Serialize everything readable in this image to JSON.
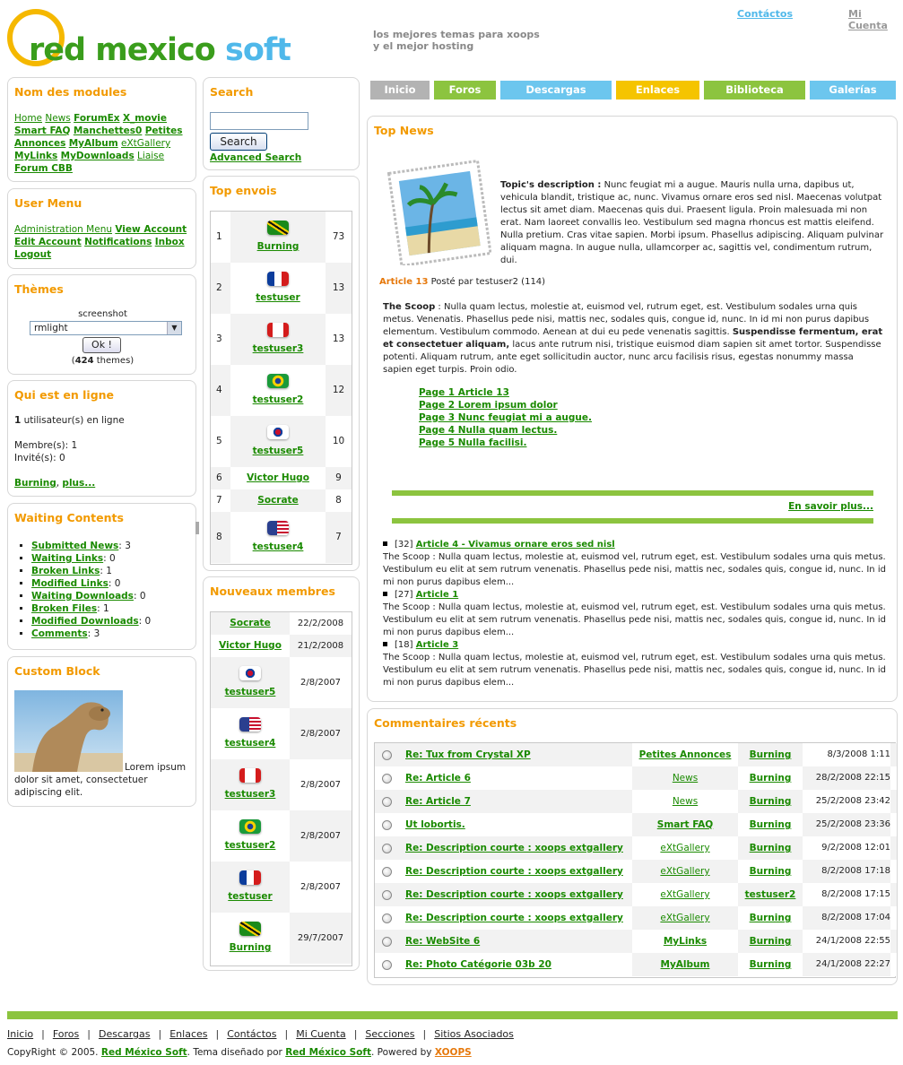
{
  "site": {
    "logo_name": "red mexico",
    "logo_name2": "soft",
    "tagline1": "los mejores temas para xoops",
    "tagline2": "y el mejor hosting",
    "top_contactos": "Contáctos",
    "top_micuenta": "Mi Cuenta"
  },
  "nav": [
    {
      "label": "Inicio",
      "color": "#b3b3b3"
    },
    {
      "label": "Foros",
      "color": "#8cc43f"
    },
    {
      "label": "Descargas",
      "color": "#6cc6ee"
    },
    {
      "label": "Enlaces",
      "color": "#f5c400"
    },
    {
      "label": "Biblioteca",
      "color": "#8cc43f"
    },
    {
      "label": "Galerías",
      "color": "#6cc6ee"
    }
  ],
  "modules": {
    "title": "Nom des modules",
    "links": [
      "Home",
      "News",
      "ForumEx",
      "X_movie",
      "Smart FAQ",
      "Manchettes0",
      "Petites Annonces",
      "MyAlbum",
      "eXtGallery",
      "MyLinks",
      "MyDownloads",
      "Liaise",
      "Forum CBB"
    ]
  },
  "usermenu": {
    "title": "User Menu",
    "links": [
      "Administration Menu",
      "View Account",
      "Edit Account",
      "Notifications",
      "Inbox",
      "Logout"
    ]
  },
  "themes": {
    "title": "Thèmes",
    "screenshot": "screenshot",
    "selected": "rmlight",
    "ok": "Ok !",
    "count": "424",
    "count_label": "themes"
  },
  "online": {
    "title": "Qui est en ligne",
    "count": "1",
    "count_label": "utilisateur(s) en ligne",
    "members": "Membre(s): 1",
    "guests": "Invité(s): 0",
    "user": "Burning",
    "more": "plus..."
  },
  "waiting": {
    "title": "Waiting Contents",
    "items": [
      {
        "label": "Submitted News",
        "count": "3"
      },
      {
        "label": "Waiting Links",
        "count": "0"
      },
      {
        "label": "Broken Links",
        "count": "1"
      },
      {
        "label": "Modified Links",
        "count": "0"
      },
      {
        "label": "Waiting Downloads",
        "count": "0"
      },
      {
        "label": "Broken Files",
        "count": "1"
      },
      {
        "label": "Modified Downloads",
        "count": "0"
      },
      {
        "label": "Comments",
        "count": "3"
      }
    ]
  },
  "custom": {
    "title": "Custom Block",
    "text": "Lorem ipsum dolor sit amet, consectetuer adipiscing elit."
  },
  "search": {
    "title": "Search",
    "button": "Search",
    "advanced": "Advanced Search"
  },
  "topposters": {
    "title": "Top envois",
    "rows": [
      {
        "rank": "1",
        "user": "Burning",
        "count": "73",
        "flag": "jamaica"
      },
      {
        "rank": "2",
        "user": "testuser",
        "count": "13",
        "flag": "france"
      },
      {
        "rank": "3",
        "user": "testuser3",
        "count": "13",
        "flag": "canada"
      },
      {
        "rank": "4",
        "user": "testuser2",
        "count": "12",
        "flag": "brazil"
      },
      {
        "rank": "5",
        "user": "testuser5",
        "count": "10",
        "flag": "korea"
      },
      {
        "rank": "6",
        "user": "Victor Hugo",
        "count": "9",
        "flag": ""
      },
      {
        "rank": "7",
        "user": "Socrate",
        "count": "8",
        "flag": ""
      },
      {
        "rank": "8",
        "user": "testuser4",
        "count": "7",
        "flag": "usa"
      }
    ]
  },
  "newmembers": {
    "title": "Nouveaux membres",
    "rows": [
      {
        "user": "Socrate",
        "date": "22/2/2008",
        "flag": ""
      },
      {
        "user": "Victor Hugo",
        "date": "21/2/2008",
        "flag": ""
      },
      {
        "user": "testuser5",
        "date": "2/8/2007",
        "flag": "korea"
      },
      {
        "user": "testuser4",
        "date": "2/8/2007",
        "flag": "usa"
      },
      {
        "user": "testuser3",
        "date": "2/8/2007",
        "flag": "canada"
      },
      {
        "user": "testuser2",
        "date": "2/8/2007",
        "flag": "brazil"
      },
      {
        "user": "testuser",
        "date": "2/8/2007",
        "flag": "france"
      },
      {
        "user": "Burning",
        "date": "29/7/2007",
        "flag": "jamaica"
      }
    ]
  },
  "topnews": {
    "title": "Top News",
    "desc_label": "Topic's description :",
    "desc": "Nunc feugiat mi a augue. Mauris nulla urna, dapibus ut, vehicula blandit, tristique ac, nunc. Vivamus ornare eros sed nisl. Maecenas volutpat lectus sit amet diam. Maecenas quis dui. Praesent ligula. Proin malesuada mi non erat. Nam laoreet convallis leo. Vestibulum sed magna rhoncus est mattis eleifend. Nulla pretium. Cras vitae sapien. Morbi ipsum. Phasellus adipiscing. Aliquam pulvinar aliquam magna. In augue nulla, ullamcorper ac, sagittis vel, condimentum rutrum, dui.",
    "article_label": "Article 13",
    "article_meta": "Posté par testuser2 (114)",
    "scoop_label": "The Scoop",
    "scoop_a": ": Nulla quam lectus, molestie at, euismod vel, rutrum eget, est. Vestibulum sodales urna quis metus. Venenatis. Phasellus pede nisi, mattis nec, sodales quis, congue id, nunc. In id mi non purus dapibus elementum. Vestibulum commodo. Aenean at dui eu pede venenatis sagittis.",
    "scoop_bold": "Suspendisse fermentum, erat et consectetuer aliquam,",
    "scoop_b": "lacus ante rutrum nisi, tristique euismod diam sapien sit amet tortor. Suspendisse potenti. Aliquam rutrum, ante eget sollicitudin auctor, nunc arcu facilisis risus, egestas nonummy massa sapien eget turpis. Proin odio.",
    "pages": [
      "Page 1 Article 13",
      "Page 2 Lorem ipsum dolor",
      "Page 3 Nunc feugiat mi a augue.",
      "Page 4 Nulla quam lectus.",
      "Page 5 Nulla facilisi."
    ],
    "more": "En savoir plus...",
    "others": [
      {
        "num": "[32]",
        "title": "Article 4 - Vivamus ornare eros sed nisl",
        "text": "The Scoop : Nulla quam lectus, molestie at, euismod vel, rutrum eget, est. Vestibulum sodales urna quis metus. Vestibulum eu elit at sem rutrum venenatis. Phasellus pede nisi, mattis nec, sodales quis, congue id, nunc. In id mi non purus dapibus elem..."
      },
      {
        "num": "[27]",
        "title": "Article 1",
        "text": "The Scoop : Nulla quam lectus, molestie at, euismod vel, rutrum eget, est. Vestibulum sodales urna quis metus. Vestibulum eu elit at sem rutrum venenatis. Phasellus pede nisi, mattis nec, sodales quis, congue id, nunc. In id mi non purus dapibus elem..."
      },
      {
        "num": "[18]",
        "title": "Article 3",
        "text": "The Scoop : Nulla quam lectus, molestie at, euismod vel, rutrum eget, est. Vestibulum sodales urna quis metus. Vestibulum eu elit at sem rutrum venenatis. Phasellus pede nisi, mattis nec, sodales quis, congue id, nunc. In id mi non purus dapibus elem..."
      }
    ]
  },
  "comments": {
    "title": "Commentaires récents",
    "rows": [
      {
        "title": "Re: Tux from Crystal XP",
        "module": "Petites Annonces",
        "mod_bold": true,
        "user": "Burning",
        "date": "8/3/2008 1:11"
      },
      {
        "title": "Re: Article 6",
        "module": "News",
        "mod_bold": false,
        "user": "Burning",
        "date": "28/2/2008 22:15"
      },
      {
        "title": "Re: Article 7",
        "module": "News",
        "mod_bold": false,
        "user": "Burning",
        "date": "25/2/2008 23:42"
      },
      {
        "title": "Ut lobortis.",
        "module": "Smart FAQ",
        "mod_bold": true,
        "user": "Burning",
        "date": "25/2/2008 23:36"
      },
      {
        "title": "Re: Description courte : xoops extgallery",
        "module": "eXtGallery",
        "mod_bold": false,
        "user": "Burning",
        "date": "9/2/2008 12:01"
      },
      {
        "title": "Re: Description courte : xoops extgallery",
        "module": "eXtGallery",
        "mod_bold": false,
        "user": "Burning",
        "date": "8/2/2008 17:18"
      },
      {
        "title": "Re: Description courte : xoops extgallery",
        "module": "eXtGallery",
        "mod_bold": false,
        "user": "testuser2",
        "date": "8/2/2008 17:15"
      },
      {
        "title": "Re: Description courte : xoops extgallery",
        "module": "eXtGallery",
        "mod_bold": false,
        "user": "Burning",
        "date": "8/2/2008 17:04"
      },
      {
        "title": "Re: WebSite 6",
        "module": "MyLinks",
        "mod_bold": true,
        "user": "Burning",
        "date": "24/1/2008 22:55"
      },
      {
        "title": "Re: Photo Catégorie 03b 20",
        "module": "MyAlbum",
        "mod_bold": true,
        "user": "Burning",
        "date": "24/1/2008 22:27"
      }
    ]
  },
  "footer": {
    "links": [
      "Inicio",
      "Foros",
      "Descargas",
      "Enlaces",
      "Contáctos",
      "Mi Cuenta",
      "Secciones",
      "Sitios Asociados"
    ],
    "copy1": "CopyRight © 2005.",
    "brand1": "Red México Soft",
    "copy2": ". Tema diseñado por",
    "brand2": "Red México Soft",
    "copy3": ". Powered by",
    "brand3": "XOOPS"
  }
}
